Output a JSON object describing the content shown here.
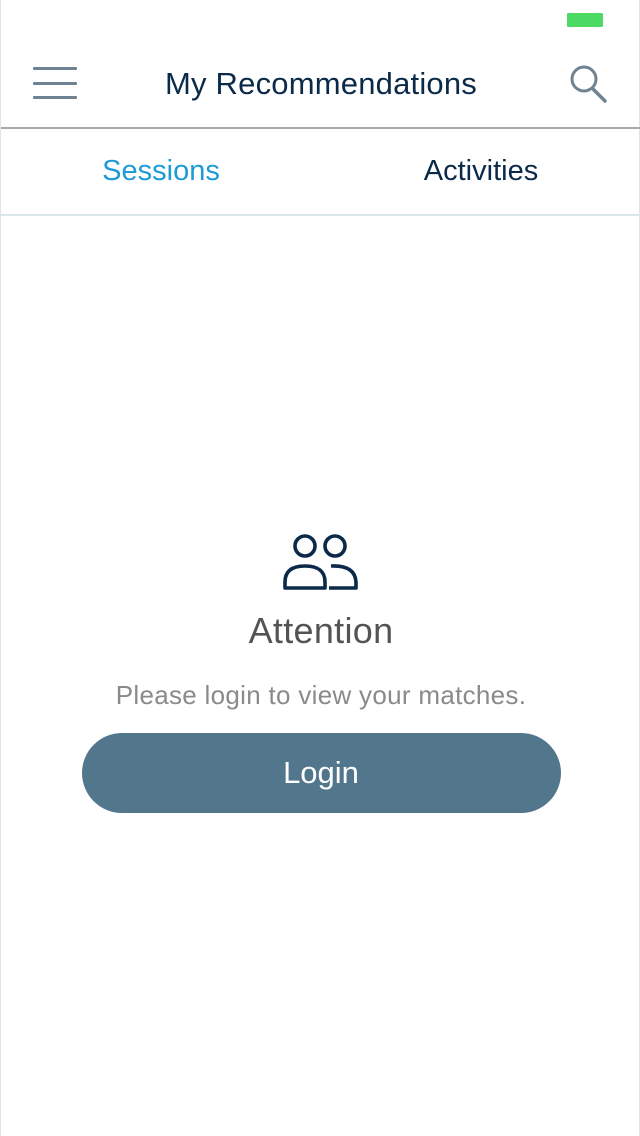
{
  "status_bar": {
    "battery_color": "#4cd964"
  },
  "header": {
    "title": "My Recommendations",
    "menu_icon": "hamburger-menu-icon",
    "search_icon": "search-icon"
  },
  "tabs": [
    {
      "label": "Sessions",
      "selected": true
    },
    {
      "label": "Activities",
      "selected": false
    }
  ],
  "empty_state": {
    "icon": "people-icon",
    "title": "Attention",
    "message": "Please login to view your matches.",
    "login_label": "Login"
  },
  "colors": {
    "accent": "#1e9bd7",
    "primary_text": "#0b2a4a",
    "button": "#52768b"
  }
}
